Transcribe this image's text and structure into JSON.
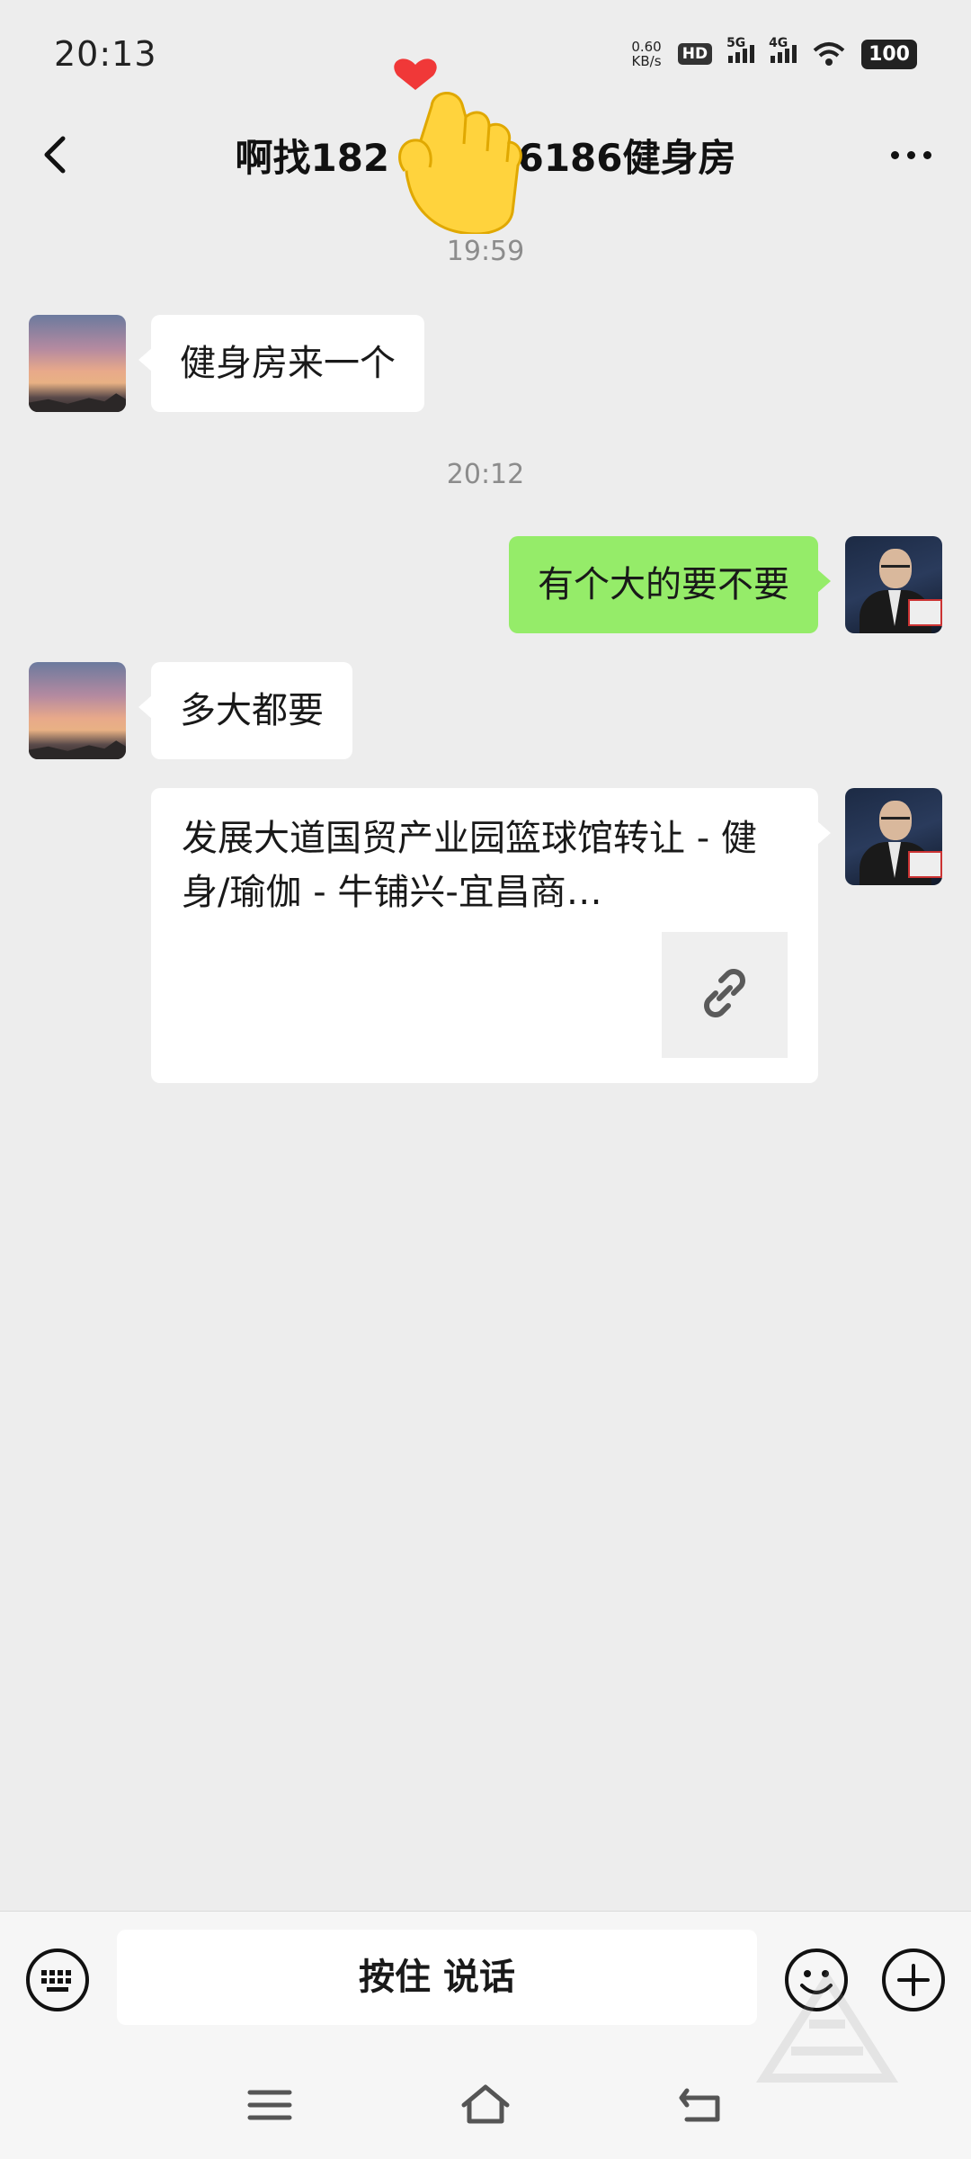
{
  "status_bar": {
    "time": "20:13",
    "net_speed_value": "0.60",
    "net_speed_unit": "KB/s",
    "hd_label": "HD",
    "sim1_label": "5G",
    "sim2_label": "4G",
    "battery": "100"
  },
  "header": {
    "title": "啊找182  286186健身房"
  },
  "messages": {
    "ts1": "19:59",
    "m1": "健身房来一个",
    "ts2": "20:12",
    "m2": "有个大的要不要",
    "m3": "多大都要",
    "link_title": "发展大道国贸产业园篮球馆转让 - 健身/瑜伽 - 牛铺兴-宜昌商…"
  },
  "input_bar": {
    "hold_to_talk": "按住 说话"
  }
}
